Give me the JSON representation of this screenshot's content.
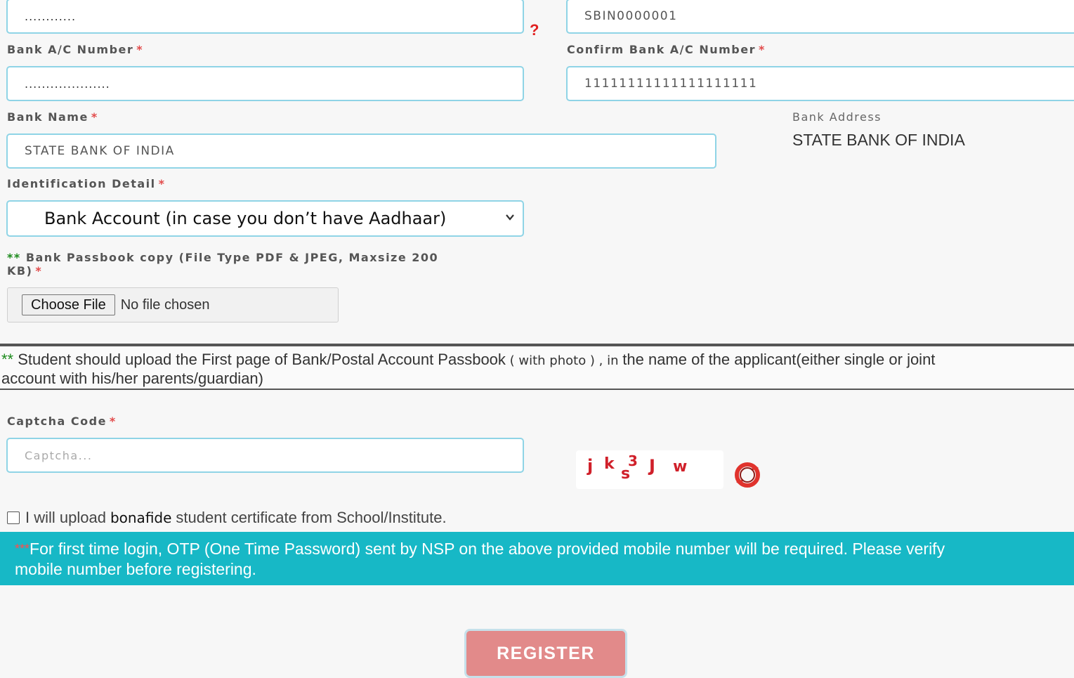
{
  "form": {
    "ifsc_masked": "............",
    "ifsc_value": "SBIN0000001",
    "help_icon": "?",
    "bank_ac_label": "Bank A/C Number",
    "bank_ac_masked": "....................",
    "confirm_ac_label": "Confirm Bank A/C Number",
    "confirm_ac_value": "11111111111111111111",
    "bank_name_label": "Bank Name",
    "bank_name_value": "STATE BANK OF INDIA",
    "bank_address_label": "Bank Address",
    "bank_address_value": "STATE BANK OF INDIA",
    "identification_label": "Identification Detail",
    "identification_value": "Bank Account (in case you don’t have Aadhaar)",
    "passbook_prefix": "**",
    "passbook_label_line1": "Bank Passbook copy (File Type PDF & JPEG, Maxsize 200",
    "passbook_label_line2": "KB)",
    "choose_file_label": "Choose File",
    "no_file_text": "No file chosen",
    "required_mark": "*"
  },
  "note": {
    "prefix": "**",
    "text_a": " Student should upload the First page of Bank/Postal Account Passbook",
    "text_b": " ( with photo ) , in ",
    "text_c": "  the name of the applicant(either single or joint",
    "text_d": "account with his/her parents/guardian)"
  },
  "captcha": {
    "label": "Captcha Code",
    "placeholder": "Captcha...",
    "refresh_icon": "refresh-icon"
  },
  "certificate": {
    "text_a": "I will upload ",
    "text_b": "bonafide",
    "text_c": " student certificate from School/Institute.",
    "checked": false
  },
  "banner": {
    "stars": "***",
    "line1": "For first time login, OTP (One Time Password) sent by NSP on the above provided mobile number will be required. Please verify",
    "line2": "mobile number before registering."
  },
  "actions": {
    "register_label": "REGISTER"
  },
  "colors": {
    "accent_border": "#8fd4e6",
    "banner_bg": "#17b8c6",
    "register_bg": "#e28a8a",
    "required": "#e24a4a"
  }
}
